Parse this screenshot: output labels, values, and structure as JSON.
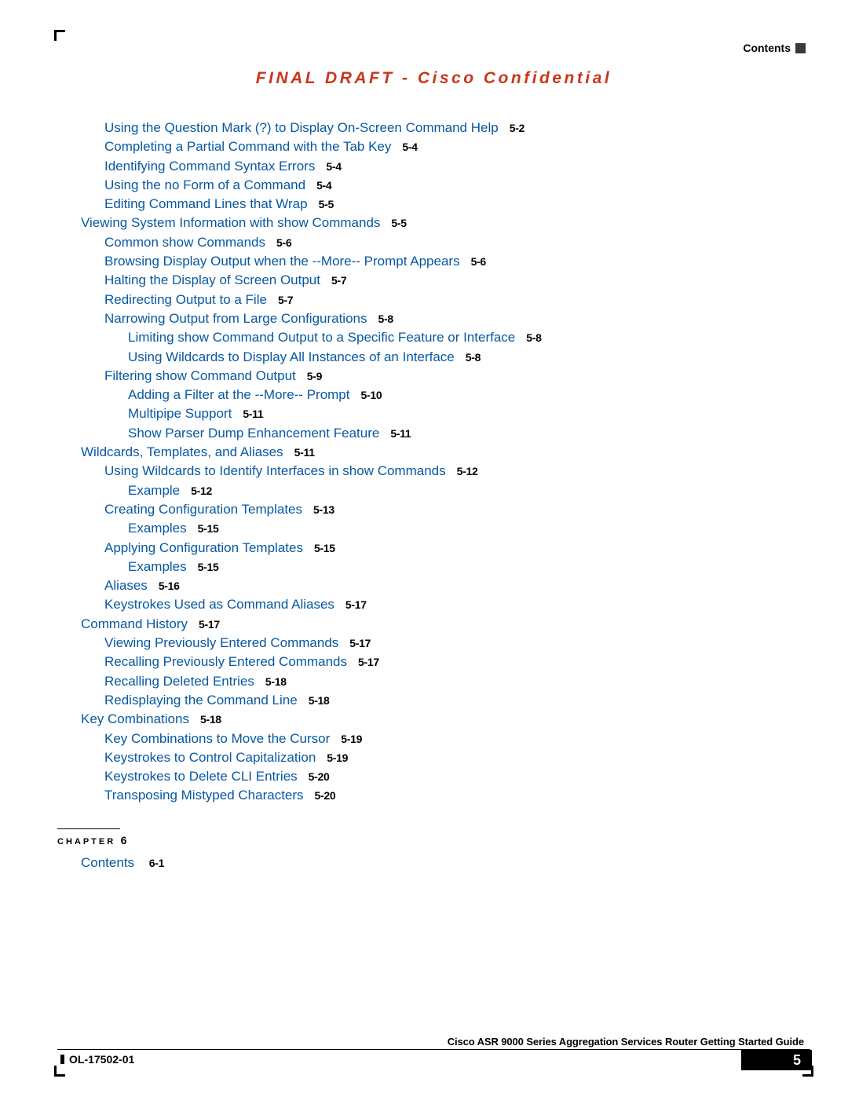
{
  "header": {
    "section": "Contents"
  },
  "banner": "FINAL DRAFT - Cisco Confidential",
  "toc": [
    {
      "lvl": 1,
      "t": "Using the Question Mark (?) to Display On-Screen Command Help",
      "p": "5-2"
    },
    {
      "lvl": 1,
      "t": "Completing a Partial Command with the Tab Key",
      "p": "5-4"
    },
    {
      "lvl": 1,
      "t": "Identifying Command Syntax Errors",
      "p": "5-4"
    },
    {
      "lvl": 1,
      "t": "Using the no Form of a Command",
      "p": "5-4"
    },
    {
      "lvl": 1,
      "t": "Editing Command Lines that Wrap",
      "p": "5-5"
    },
    {
      "lvl": 0,
      "t": "Viewing System Information with show Commands",
      "p": "5-5"
    },
    {
      "lvl": 1,
      "t": "Common show Commands",
      "p": "5-6"
    },
    {
      "lvl": 1,
      "t": "Browsing Display Output when the --More-- Prompt Appears",
      "p": "5-6"
    },
    {
      "lvl": 1,
      "t": "Halting the Display of Screen Output",
      "p": "5-7"
    },
    {
      "lvl": 1,
      "t": "Redirecting Output to a File",
      "p": "5-7"
    },
    {
      "lvl": 1,
      "t": "Narrowing Output from Large Configurations",
      "p": "5-8"
    },
    {
      "lvl": 2,
      "t": "Limiting show Command Output to a Specific Feature or Interface",
      "p": "5-8"
    },
    {
      "lvl": 2,
      "t": "Using Wildcards to Display All Instances of an Interface",
      "p": "5-8"
    },
    {
      "lvl": 1,
      "t": "Filtering show Command Output",
      "p": "5-9"
    },
    {
      "lvl": 2,
      "t": "Adding a Filter at the --More-- Prompt",
      "p": "5-10"
    },
    {
      "lvl": 2,
      "t": "Multipipe Support",
      "p": "5-11"
    },
    {
      "lvl": 2,
      "t": "Show Parser Dump Enhancement Feature",
      "p": "5-11"
    },
    {
      "lvl": 0,
      "t": "Wildcards, Templates, and Aliases",
      "p": "5-11"
    },
    {
      "lvl": 1,
      "t": "Using Wildcards to Identify Interfaces in show Commands",
      "p": "5-12"
    },
    {
      "lvl": 2,
      "t": "Example",
      "p": "5-12"
    },
    {
      "lvl": 1,
      "t": "Creating Configuration Templates",
      "p": "5-13"
    },
    {
      "lvl": 2,
      "t": "Examples",
      "p": "5-15"
    },
    {
      "lvl": 1,
      "t": "Applying Configuration Templates",
      "p": "5-15"
    },
    {
      "lvl": 2,
      "t": "Examples",
      "p": "5-15"
    },
    {
      "lvl": 1,
      "t": "Aliases",
      "p": "5-16"
    },
    {
      "lvl": 1,
      "t": "Keystrokes Used as Command Aliases",
      "p": "5-17"
    },
    {
      "lvl": 0,
      "t": "Command History",
      "p": "5-17"
    },
    {
      "lvl": 1,
      "t": "Viewing Previously Entered Commands",
      "p": "5-17"
    },
    {
      "lvl": 1,
      "t": "Recalling Previously Entered Commands",
      "p": "5-17"
    },
    {
      "lvl": 1,
      "t": "Recalling Deleted Entries",
      "p": "5-18"
    },
    {
      "lvl": 1,
      "t": "Redisplaying the Command Line",
      "p": "5-18"
    },
    {
      "lvl": 0,
      "t": "Key Combinations",
      "p": "5-18"
    },
    {
      "lvl": 1,
      "t": "Key Combinations to Move the Cursor",
      "p": "5-19"
    },
    {
      "lvl": 1,
      "t": "Keystrokes to Control Capitalization",
      "p": "5-19"
    },
    {
      "lvl": 1,
      "t": "Keystrokes to Delete CLI Entries",
      "p": "5-20"
    },
    {
      "lvl": 1,
      "t": "Transposing Mistyped Characters",
      "p": "5-20"
    }
  ],
  "chapter": {
    "label": "CHAPTER",
    "num": "6",
    "entry_title": "Contents",
    "entry_page": "6-1"
  },
  "footer": {
    "title": "Cisco ASR 9000 Series Aggregation Services Router Getting Started Guide",
    "doc_id": "OL-17502-01",
    "page": "5"
  }
}
